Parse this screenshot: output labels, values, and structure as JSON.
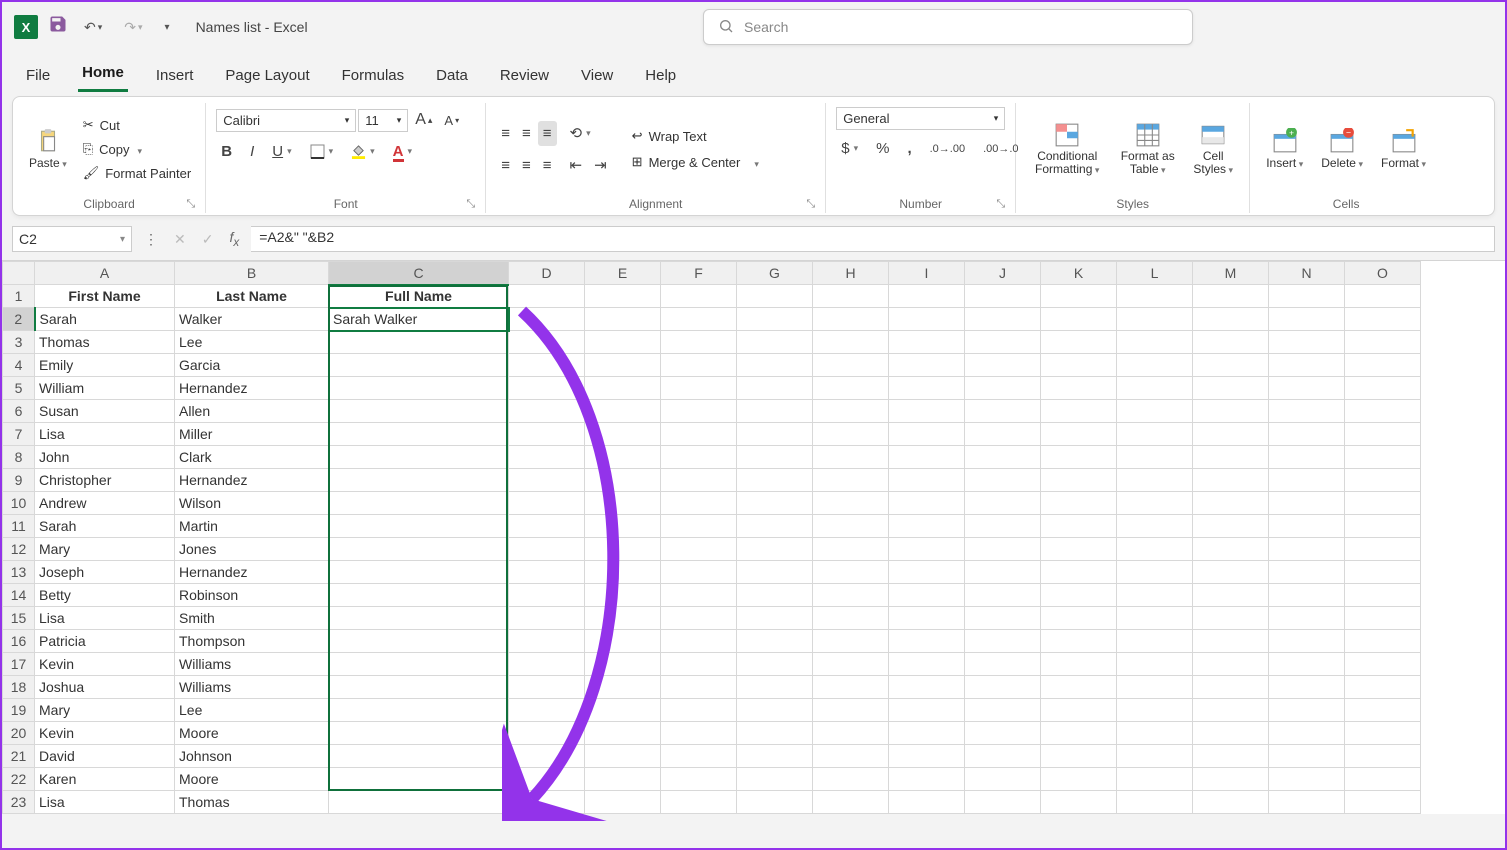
{
  "title": "Names list  -  Excel",
  "search_placeholder": "Search",
  "tabs": [
    "File",
    "Home",
    "Insert",
    "Page Layout",
    "Formulas",
    "Data",
    "Review",
    "View",
    "Help"
  ],
  "active_tab": "Home",
  "clipboard": {
    "paste": "Paste",
    "cut": "Cut",
    "copy": "Copy",
    "painter": "Format Painter",
    "label": "Clipboard"
  },
  "font": {
    "name": "Calibri",
    "size": "11",
    "label": "Font"
  },
  "alignment": {
    "wrap": "Wrap Text",
    "merge": "Merge & Center",
    "label": "Alignment"
  },
  "number": {
    "format": "General",
    "label": "Number"
  },
  "styles": {
    "cond": "Conditional Formatting",
    "table": "Format as Table",
    "cell": "Cell Styles",
    "label": "Styles"
  },
  "cells": {
    "insert": "Insert",
    "delete": "Delete",
    "format": "Format",
    "label": "Cells"
  },
  "namebox": "C2",
  "formula": "=A2&\" \"&B2",
  "columns": [
    "A",
    "B",
    "C",
    "D",
    "E",
    "F",
    "G",
    "H",
    "I",
    "J",
    "K",
    "L",
    "M",
    "N",
    "O"
  ],
  "headers": {
    "a": "First Name",
    "b": "Last Name",
    "c": "Full Name"
  },
  "rows": [
    {
      "a": "Sarah",
      "b": "Walker",
      "c": "Sarah Walker"
    },
    {
      "a": "Thomas",
      "b": "Lee",
      "c": ""
    },
    {
      "a": "Emily",
      "b": "Garcia",
      "c": ""
    },
    {
      "a": "William",
      "b": "Hernandez",
      "c": ""
    },
    {
      "a": "Susan",
      "b": "Allen",
      "c": ""
    },
    {
      "a": "Lisa",
      "b": "Miller",
      "c": ""
    },
    {
      "a": "John",
      "b": "Clark",
      "c": ""
    },
    {
      "a": "Christopher",
      "b": "Hernandez",
      "c": ""
    },
    {
      "a": "Andrew",
      "b": "Wilson",
      "c": ""
    },
    {
      "a": "Sarah",
      "b": "Martin",
      "c": ""
    },
    {
      "a": "Mary",
      "b": "Jones",
      "c": ""
    },
    {
      "a": "Joseph",
      "b": "Hernandez",
      "c": ""
    },
    {
      "a": "Betty",
      "b": "Robinson",
      "c": ""
    },
    {
      "a": "Lisa",
      "b": "Smith",
      "c": ""
    },
    {
      "a": "Patricia",
      "b": "Thompson",
      "c": ""
    },
    {
      "a": "Kevin",
      "b": "Williams",
      "c": ""
    },
    {
      "a": "Joshua",
      "b": "Williams",
      "c": ""
    },
    {
      "a": "Mary",
      "b": "Lee",
      "c": ""
    },
    {
      "a": "Kevin",
      "b": "Moore",
      "c": ""
    },
    {
      "a": "David",
      "b": "Johnson",
      "c": ""
    },
    {
      "a": "Karen",
      "b": "Moore",
      "c": ""
    },
    {
      "a": "Lisa",
      "b": "Thomas",
      "c": ""
    }
  ]
}
